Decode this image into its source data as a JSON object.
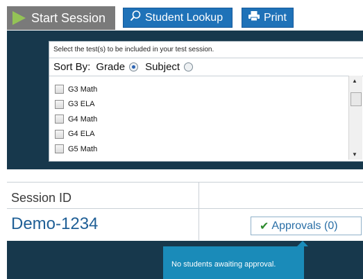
{
  "toolbar": {
    "start_label": "Start Session",
    "lookup_label": "Student Lookup",
    "print_label": "Print",
    "start_icon": "play-icon",
    "lookup_icon": "search-icon",
    "print_icon": "printer-icon"
  },
  "chooser": {
    "instruction": "Select the test(s) to be included in your test session.",
    "sort_label": "Sort By:",
    "sort_options": [
      {
        "label": "Grade",
        "selected": true
      },
      {
        "label": "Subject",
        "selected": false
      }
    ],
    "tests": [
      {
        "label": "G3 Math",
        "checked": false
      },
      {
        "label": "G3 ELA",
        "checked": false
      },
      {
        "label": "G4 Math",
        "checked": false
      },
      {
        "label": "G4 ELA",
        "checked": false
      },
      {
        "label": "G5 Math",
        "checked": false
      }
    ]
  },
  "session": {
    "id_label": "Session ID",
    "id_value": "Demo-1234",
    "approvals_label": "Approvals (0)",
    "approvals_icon": "checkmark-icon",
    "approval_message": "No students awaiting approval."
  },
  "colors": {
    "dark_panel": "#17384c",
    "button_blue": "#1f72b8",
    "start_gray": "#7a7a7a",
    "play_green": "#94c356",
    "tooltip_blue": "#1a8bb9",
    "session_blue": "#1f5f96"
  }
}
